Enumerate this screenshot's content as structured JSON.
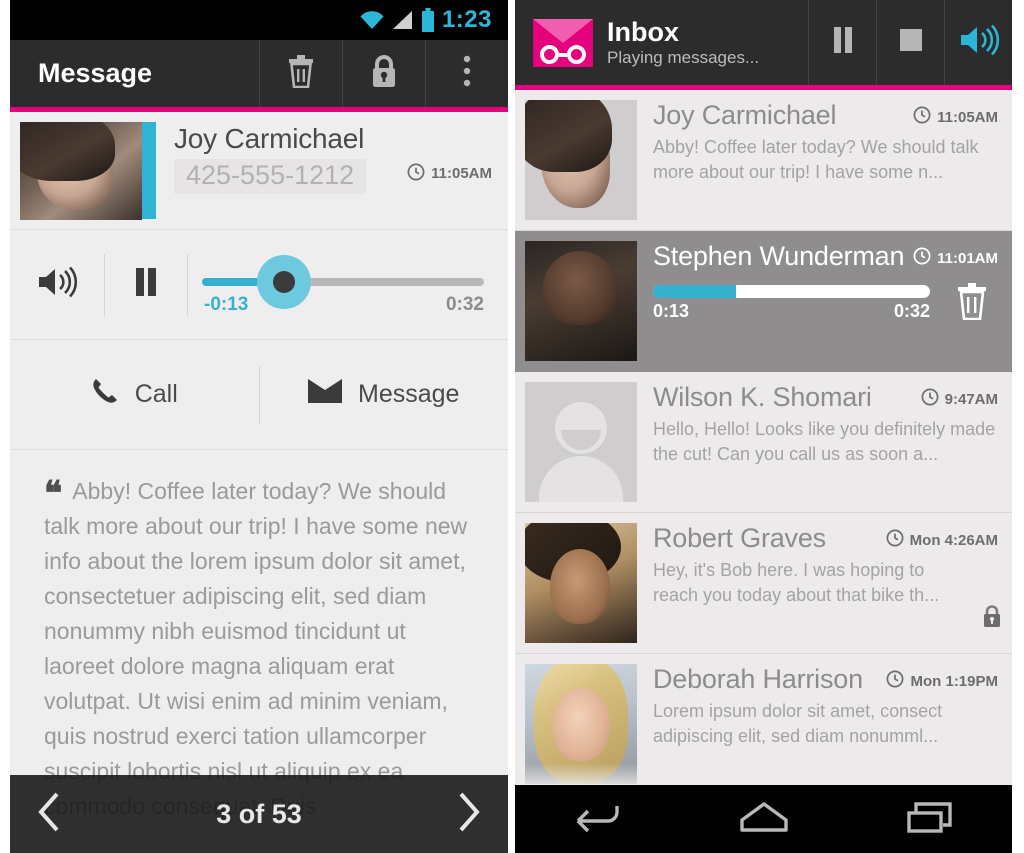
{
  "left_panel": {
    "status_bar": {
      "time": "1:23",
      "icons": [
        "wifi-icon",
        "signal-icon",
        "battery-icon"
      ]
    },
    "action_bar": {
      "title": "Message",
      "buttons": [
        {
          "name": "delete-button",
          "icon": "trash-icon"
        },
        {
          "name": "lock-button",
          "icon": "lock-icon"
        },
        {
          "name": "overflow-button",
          "icon": "more-vertical-icon"
        }
      ]
    },
    "contact": {
      "name": "Joy Carmichael",
      "phone": "425-555-1212",
      "time": "11:05AM",
      "time_icon": "clock-icon",
      "accent_color": "#2fb4d4"
    },
    "player": {
      "volume_icon": "speaker-icon",
      "pause_icon": "pause-icon",
      "elapsed_label": "-0:13",
      "duration_label": "0:32",
      "progress_percent": 30
    },
    "quick_actions": [
      {
        "name": "call-action",
        "icon": "phone-icon",
        "label": "Call"
      },
      {
        "name": "message-action",
        "icon": "envelope-icon",
        "label": "Message"
      }
    ],
    "transcript": {
      "quote_icon": "quote-mark-icon",
      "text": "Abby! Coffee later today? We should talk more about our trip! I have some new info about the lorem ipsum dolor sit amet, consectetuer adipiscing elit, sed diam nonummy nibh euismod tincidunt ut laoreet dolore magna aliquam erat volutpat. Ut wisi enim ad minim veniam, quis nostrud exerci tation ullamcorper suscipit lobortis nisl ut aliquip ex ea commodo consequat. Duis"
    },
    "pager": {
      "prev_icon": "chevron-left-icon",
      "label": "3 of 53",
      "next_icon": "chevron-right-icon"
    }
  },
  "right_panel": {
    "header": {
      "logo_icon": "envelope-cassette-logo",
      "title": "Inbox",
      "subtitle": "Playing messages...",
      "accent_color": "#e6007e",
      "buttons": [
        {
          "name": "pause-button",
          "icon": "pause-icon"
        },
        {
          "name": "stop-button",
          "icon": "stop-icon"
        },
        {
          "name": "speaker-button",
          "icon": "speaker-icon",
          "color": "#29b6d8"
        }
      ]
    },
    "messages": [
      {
        "name": "Joy Carmichael",
        "time": "11:05AM",
        "preview": "Abby! Coffee later today? We should talk more about our trip! I have some n...",
        "avatar": "photo-joy",
        "state": "read",
        "locked": false
      },
      {
        "name": "Stephen Wunderman",
        "time": "11:01AM",
        "preview": "",
        "avatar": "photo-stephen",
        "state": "playing",
        "locked": false,
        "player": {
          "elapsed_label": "0:13",
          "duration_label": "0:32",
          "progress_percent": 30,
          "delete_icon": "trash-icon"
        }
      },
      {
        "name": "Wilson K. Shomari",
        "time": "9:47AM",
        "preview": "Hello, Hello! Looks like you definitely made the cut! Can you call us as soon a...",
        "avatar": "placeholder-person",
        "state": "read",
        "locked": false
      },
      {
        "name": "Robert Graves",
        "time": "Mon 4:26AM",
        "preview": "Hey, it's Bob here. I was hoping to reach you today about that bike th...",
        "avatar": "photo-robert",
        "state": "read",
        "locked": true,
        "lock_icon": "lock-icon"
      },
      {
        "name": "Deborah Harrison",
        "time": "Mon 1:19PM",
        "preview": "Lorem ipsum dolor sit amet, consect adipiscing elit, sed diam nonumml...",
        "avatar": "photo-deborah",
        "state": "read",
        "locked": false
      }
    ],
    "nav_bar": [
      {
        "name": "back-button",
        "icon": "back-arrow-icon"
      },
      {
        "name": "home-button",
        "icon": "home-icon"
      },
      {
        "name": "recents-button",
        "icon": "recents-icon"
      }
    ]
  }
}
